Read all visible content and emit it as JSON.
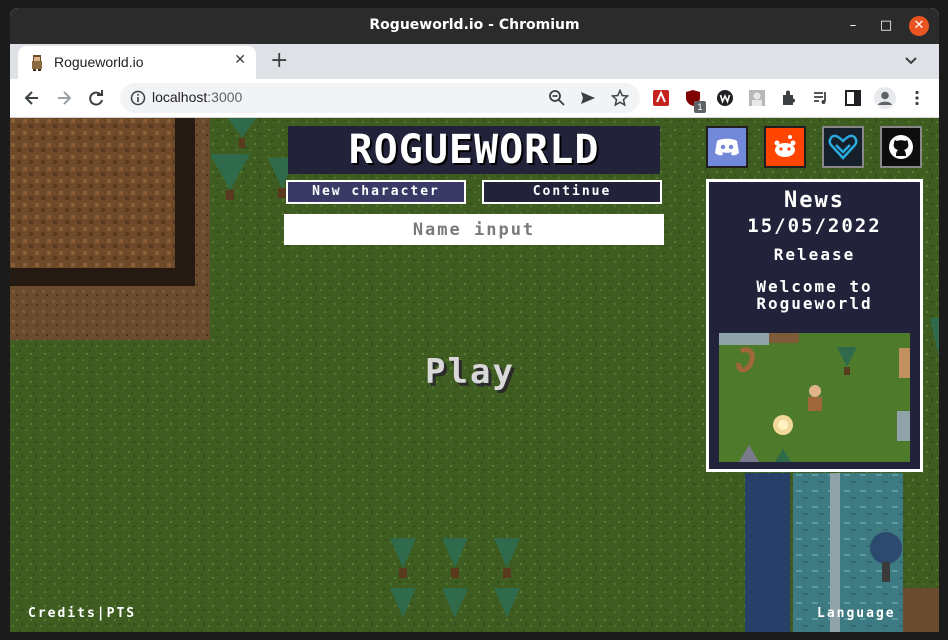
{
  "window": {
    "title": "Rogueworld.io - Chromium",
    "controls": {
      "minimize": "–",
      "maximize": "□",
      "close": "✕"
    }
  },
  "tabs": [
    {
      "title": "Rogueworld.io",
      "close": "✕"
    }
  ],
  "tabstrip": {
    "new_tab": "+"
  },
  "toolbar": {
    "url_host": "localhost",
    "url_port": ":3000",
    "extension_badge": "1"
  },
  "colors": {
    "accent_close": "#e95420",
    "game_panel": "#22223a",
    "new_character_button": "#3a3a66",
    "discord": "#7289da",
    "reddit": "#ff4500"
  },
  "icons": [
    "back-icon",
    "forward-icon",
    "reload-icon",
    "info-icon",
    "zoom-icon",
    "send-icon",
    "star-icon",
    "extensions-icon",
    "playlist-icon",
    "sidepanel-icon",
    "profile-icon",
    "kebab-menu-icon",
    "discord-icon",
    "reddit-icon",
    "kofi-icon",
    "github-icon"
  ],
  "game": {
    "logo": "ROGUEWORLD",
    "new_character": "New character",
    "continue": "Continue",
    "name_placeholder": "Name input",
    "play": "Play",
    "news": {
      "title": "News",
      "date": "15/05/2022",
      "headline": "Release",
      "body": "Welcome to Rogueworld"
    },
    "credits": "Credits",
    "separator": "|",
    "pts": "PTS",
    "language": "Language"
  }
}
